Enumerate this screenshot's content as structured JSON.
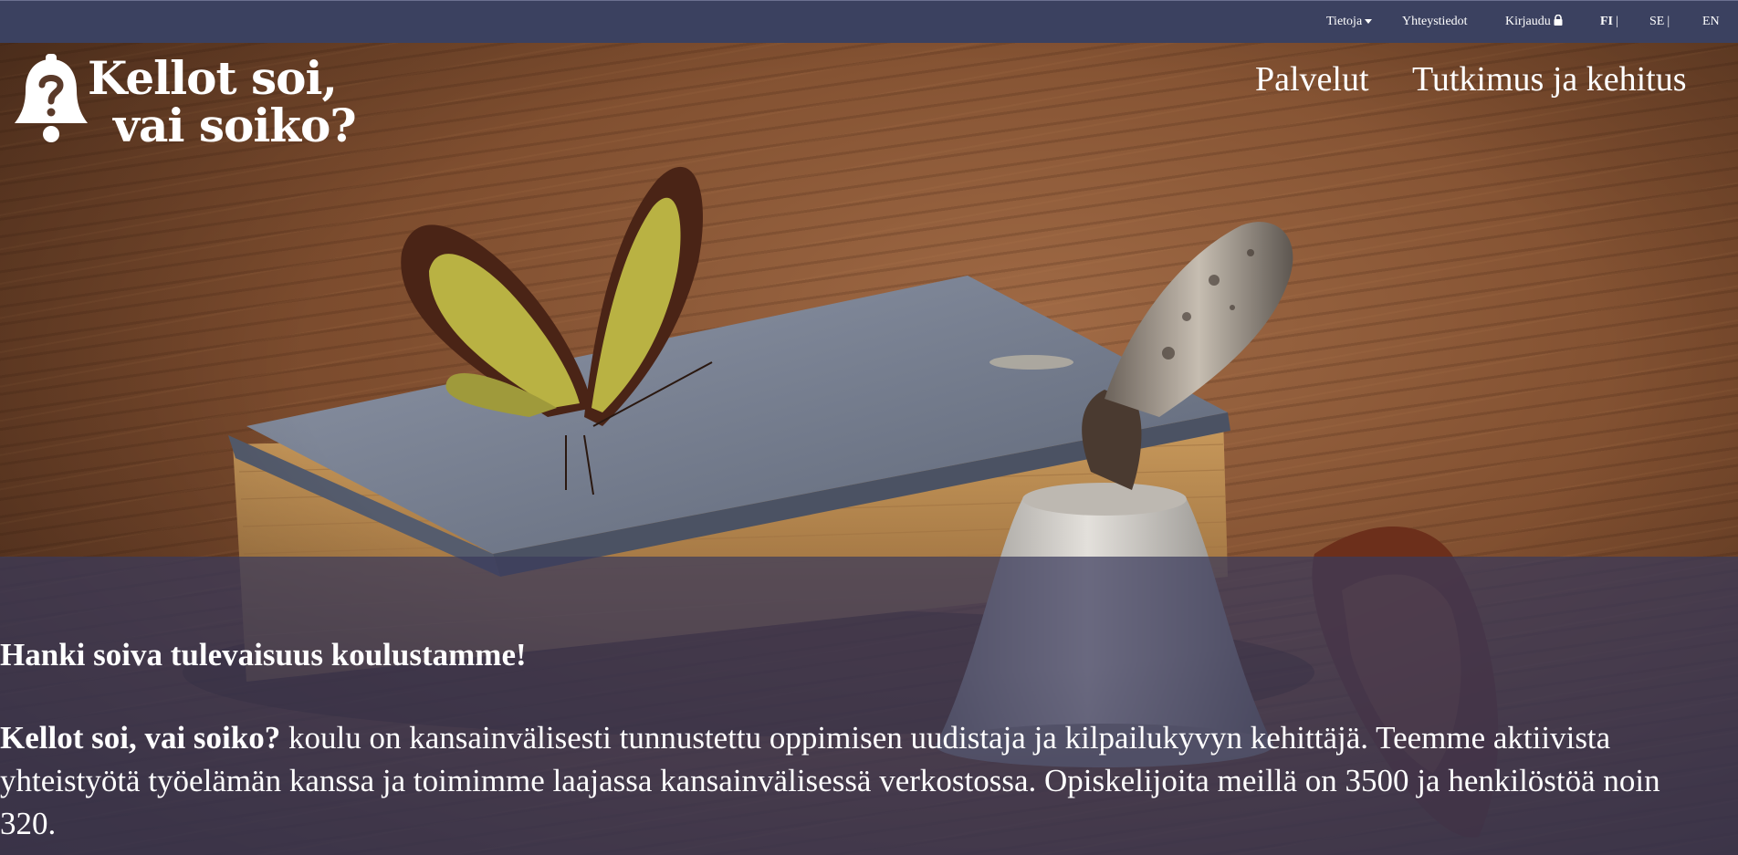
{
  "topbar": {
    "about": "Tietoja",
    "contact": "Yhteystiedot",
    "login": "Kirjaudu",
    "lang_fi": "FI",
    "lang_se": "SE",
    "lang_en": "EN",
    "separator": "|"
  },
  "logo": {
    "line1": "Kellot soi,",
    "line2": "vai soiko?"
  },
  "nav": {
    "services": "Palvelut",
    "research": "Tutkimus ja kehitus"
  },
  "hero": {
    "heading": "Hanki soiva tulevaisuus koulustamme!",
    "body_strong": "Kellot soi, vai soiko?",
    "body_text": " koulu on kansainvälisesti tunnustettu oppimisen uudistaja ja kilpailukyvyn kehittäjä. Teemme aktiivista yhteistyötä työelämän kanssa ja toimimme laajassa kansainvälisessä verkostossa. Opiskelijoita meillä on 3500 ja henkilöstöä noin 320."
  },
  "icons": {
    "about_dropdown": "caret-down-icon",
    "login": "lock-icon",
    "logo": "bell-question-icon"
  },
  "colors": {
    "topbar_bg": "#3b4160",
    "overlay_bg": "#3a3a5c",
    "text": "#ffffff"
  }
}
